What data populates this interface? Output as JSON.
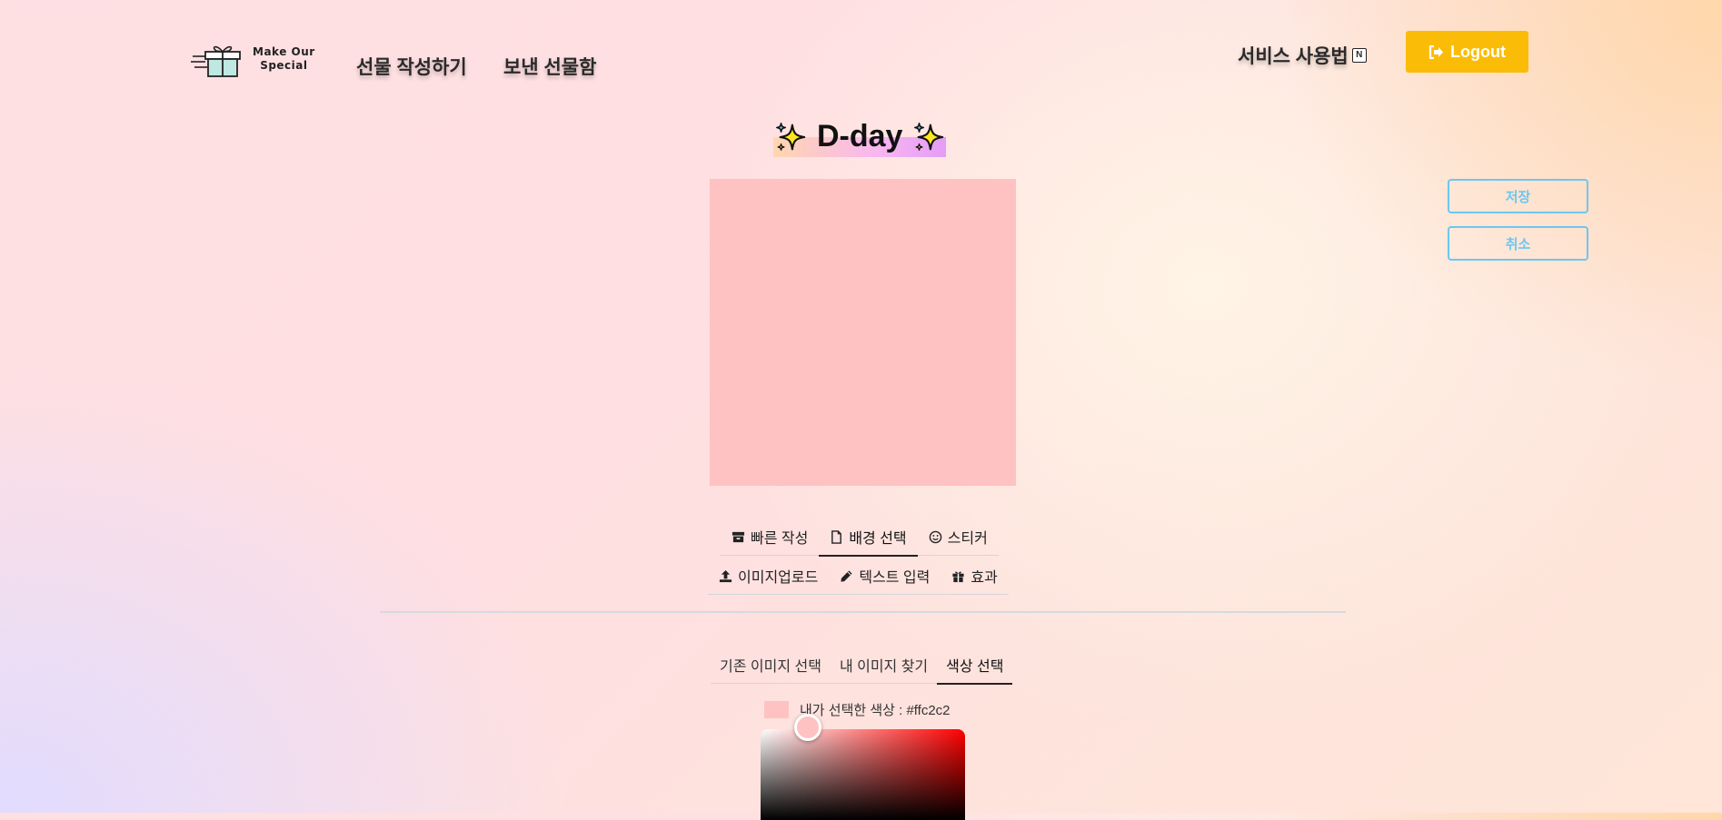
{
  "header": {
    "logo_text_line1": "Make Our",
    "logo_text_line2": "Special",
    "nav": [
      {
        "label": "선물 작성하기"
      },
      {
        "label": "보낸 선물함"
      }
    ],
    "howto_label": "서비스 사용법",
    "notion_glyph": "N",
    "logout_label": "Logout"
  },
  "title": {
    "text": "D-day",
    "highlight_colors": [
      "#ffd6b0",
      "#e59cf6"
    ]
  },
  "canvas": {
    "background_color": "#ffc2c2"
  },
  "side_buttons": {
    "save_label": "저장",
    "cancel_label": "취소",
    "color": "#6cc7f2"
  },
  "editor_tabs": {
    "row1": [
      {
        "label": "빠른 작성",
        "icon": "archive-icon"
      },
      {
        "label": "배경 선택",
        "icon": "file-icon",
        "active": true
      },
      {
        "label": "스티커",
        "icon": "smile-icon"
      }
    ],
    "row2": [
      {
        "label": "이미지업로드",
        "icon": "upload-icon"
      },
      {
        "label": "텍스트 입력",
        "icon": "pencil-icon"
      },
      {
        "label": "효과",
        "icon": "gift-icon"
      }
    ]
  },
  "background_tabs": [
    {
      "label": "기존 이미지 선택"
    },
    {
      "label": "내 이미지 찾기"
    },
    {
      "label": "색상 선택",
      "active": true
    }
  ],
  "color_picker": {
    "label": "내가 선택한 색상 : #ffc2c2",
    "selected_color": "#ffc2c2"
  },
  "colors": {
    "accent": "#fbbc08",
    "outline_button": "#6cc7f2"
  }
}
